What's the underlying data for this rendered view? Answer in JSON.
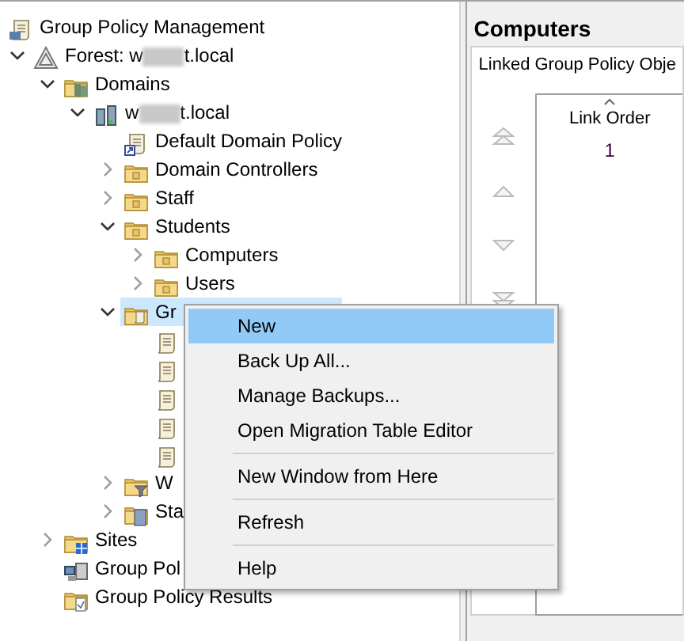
{
  "tree": [
    {
      "label_parts": [
        "Group Policy Management"
      ],
      "kind": "console",
      "selected": false,
      "children": [
        {
          "label_parts": [
            "Forest: w",
            "t.local"
          ],
          "kind": "forest",
          "expanded": true,
          "selected": false,
          "children": [
            {
              "label_parts": [
                "Domains"
              ],
              "kind": "domains",
              "expanded": true,
              "selected": false,
              "children": [
                {
                  "label_parts": [
                    "w",
                    "t.local"
                  ],
                  "kind": "domain",
                  "expanded": true,
                  "selected": false,
                  "children": [
                    {
                      "label_parts": [
                        "Default Domain Policy"
                      ],
                      "kind": "gpo-link",
                      "selected": false
                    },
                    {
                      "label_parts": [
                        "Domain Controllers"
                      ],
                      "kind": "ou",
                      "expanded": false,
                      "selected": false
                    },
                    {
                      "label_parts": [
                        "Staff"
                      ],
                      "kind": "ou",
                      "expanded": false,
                      "selected": false
                    },
                    {
                      "label_parts": [
                        "Students"
                      ],
                      "kind": "ou",
                      "expanded": true,
                      "selected": false,
                      "children": [
                        {
                          "label_parts": [
                            "Computers"
                          ],
                          "kind": "ou",
                          "expanded": false,
                          "selected": false
                        },
                        {
                          "label_parts": [
                            "Users"
                          ],
                          "kind": "ou",
                          "expanded": false,
                          "selected": false
                        }
                      ]
                    },
                    {
                      "label_parts": [
                        "Gr"
                      ],
                      "kind": "gpo-folder",
                      "expanded": true,
                      "selected": true,
                      "children": [
                        {
                          "kind": "gpo",
                          "selected": false
                        },
                        {
                          "kind": "gpo",
                          "selected": false
                        },
                        {
                          "kind": "gpo",
                          "selected": false
                        },
                        {
                          "kind": "gpo",
                          "selected": false
                        },
                        {
                          "kind": "gpo",
                          "selected": false
                        }
                      ]
                    },
                    {
                      "label_parts": [
                        "W"
                      ],
                      "kind": "wmi",
                      "expanded": false,
                      "selected": false
                    },
                    {
                      "label_parts": [
                        "Sta"
                      ],
                      "kind": "starter",
                      "expanded": false,
                      "selected": false
                    }
                  ]
                }
              ]
            },
            {
              "label_parts": [
                "Sites"
              ],
              "kind": "sites",
              "expanded": false,
              "selected": false
            },
            {
              "label_parts": [
                "Group Pol"
              ],
              "kind": "modeling",
              "selected": false
            },
            {
              "label_parts": [
                "Group Policy Results"
              ],
              "kind": "results",
              "selected": false
            }
          ]
        }
      ]
    }
  ],
  "context_menu": [
    {
      "kind": "item",
      "label": "New",
      "highlighted": true
    },
    {
      "kind": "item",
      "label": "Back Up All...",
      "highlighted": false
    },
    {
      "kind": "item",
      "label": "Manage Backups...",
      "highlighted": false
    },
    {
      "kind": "item",
      "label": "Open Migration Table Editor",
      "highlighted": false
    },
    {
      "kind": "separator"
    },
    {
      "kind": "item",
      "label": "New Window from Here",
      "highlighted": false
    },
    {
      "kind": "separator"
    },
    {
      "kind": "item",
      "label": "Refresh",
      "highlighted": false
    },
    {
      "kind": "separator"
    },
    {
      "kind": "item",
      "label": "Help",
      "highlighted": false
    }
  ],
  "detail": {
    "title": "Computers",
    "tab": "Linked Group Policy Obje",
    "column": "Link Order",
    "rows": [
      "1"
    ]
  }
}
